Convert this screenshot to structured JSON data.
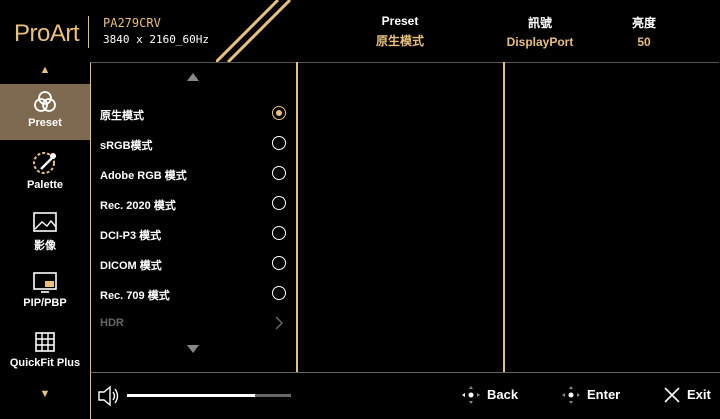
{
  "header": {
    "logo": "ProArt",
    "model": "PA279CRV",
    "resolution": "3840 x 2160_60Hz",
    "preset_label": "Preset",
    "preset_value": "原生模式",
    "input_label": "訊號",
    "input_value": "DisplayPort",
    "brightness_label": "亮度",
    "brightness_value": "50"
  },
  "sidebar": {
    "items": [
      {
        "label": "Preset",
        "icon": "palette-circles-icon",
        "active": true
      },
      {
        "label": "Palette",
        "icon": "color-dropper-icon",
        "active": false
      },
      {
        "label": "影像",
        "icon": "image-icon",
        "active": false
      },
      {
        "label": "PIP/PBP",
        "icon": "pip-icon",
        "active": false
      },
      {
        "label": "QuickFit Plus",
        "icon": "grid-icon",
        "active": false
      }
    ]
  },
  "preset_list": {
    "options": [
      {
        "label": "原生模式",
        "selected": true
      },
      {
        "label": "sRGB模式",
        "selected": false
      },
      {
        "label": "Adobe RGB 模式",
        "selected": false
      },
      {
        "label": "Rec. 2020 模式",
        "selected": false
      },
      {
        "label": "DCI-P3 模式",
        "selected": false
      },
      {
        "label": "DICOM 模式",
        "selected": false
      },
      {
        "label": "Rec. 709 模式",
        "selected": false
      },
      {
        "label": "HDR",
        "selected": false,
        "submenu": true,
        "disabled": true
      }
    ]
  },
  "footer": {
    "volume_level": 0.78,
    "back_label": "Back",
    "enter_label": "Enter",
    "exit_label": "Exit"
  },
  "colors": {
    "accent": "#e8c07a",
    "active_bg": "#7d6a50"
  }
}
